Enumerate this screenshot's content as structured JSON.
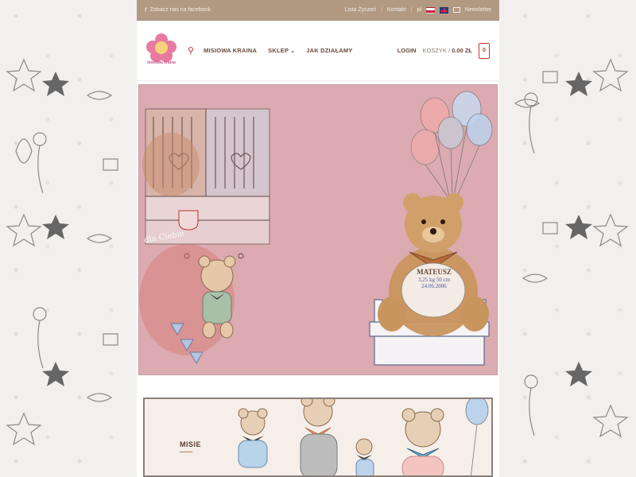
{
  "topbar": {
    "facebook_text": "Zobacz nas na facebook",
    "links": [
      "Lista Życzeń",
      "Kontakt",
      "pl"
    ],
    "newsletter": "Newsletter"
  },
  "header": {
    "logo_text": "misiowa kraina",
    "nav": [
      "MISIOWA KRAINA",
      "SKLEP",
      "JAK DZIAŁAMY"
    ],
    "sklep_chevron": "⌄",
    "login": "LOGIN",
    "cart_label": "KOSZYK",
    "cart_separator": "/",
    "cart_total": "0.00 ZŁ",
    "cart_count": "0"
  },
  "hero": {
    "tag_lines": [
      "MATEUSZ",
      "3,25 kg  50 cm",
      "24.06.2006"
    ],
    "cup_text": "dla Ciebie"
  },
  "banner": {
    "title": "MISIE"
  },
  "colors": {
    "topbar": "#b29a82",
    "accent": "#c0392b",
    "nav_text": "#6b4a3a",
    "hero_bg": "#dcaab1"
  }
}
